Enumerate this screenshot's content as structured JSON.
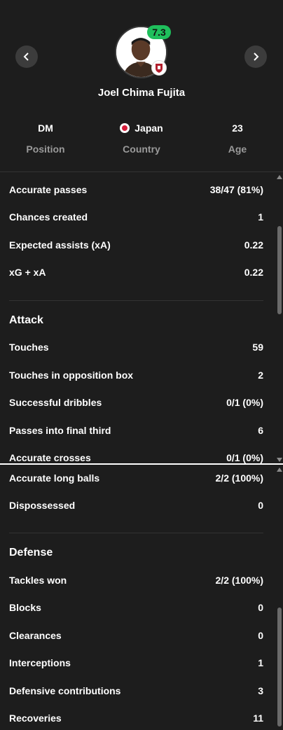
{
  "player": {
    "name": "Joel Chima Fujita",
    "rating": "7.3",
    "position_value": "DM",
    "position_label": "Position",
    "country_value": "Japan",
    "country_label": "Country",
    "age_value": "23",
    "age_label": "Age"
  },
  "panel1": {
    "rows_top": [
      {
        "label": "Accurate passes",
        "value": "38/47 (81%)"
      },
      {
        "label": "Chances created",
        "value": "1"
      },
      {
        "label": "Expected assists (xA)",
        "value": "0.22"
      },
      {
        "label": "xG + xA",
        "value": "0.22"
      }
    ],
    "attack_title": "Attack",
    "attack_rows": [
      {
        "label": "Touches",
        "value": "59"
      },
      {
        "label": "Touches in opposition box",
        "value": "2"
      },
      {
        "label": "Successful dribbles",
        "value": "0/1 (0%)"
      },
      {
        "label": "Passes into final third",
        "value": "6"
      },
      {
        "label": "Accurate crosses",
        "value": "0/1 (0%)"
      }
    ]
  },
  "panel2": {
    "rows_top": [
      {
        "label": "Accurate long balls",
        "value": "2/2 (100%)"
      },
      {
        "label": "Dispossessed",
        "value": "0"
      }
    ],
    "defense_title": "Defense",
    "defense_rows": [
      {
        "label": "Tackles won",
        "value": "2/2 (100%)"
      },
      {
        "label": "Blocks",
        "value": "0"
      },
      {
        "label": "Clearances",
        "value": "0"
      },
      {
        "label": "Interceptions",
        "value": "1"
      },
      {
        "label": "Defensive contributions",
        "value": "3"
      },
      {
        "label": "Recoveries",
        "value": "11"
      }
    ]
  },
  "colors": {
    "background": "#1d1d1d",
    "rating_badge": "#1fbf5c",
    "muted_text": "#9a9a9a"
  },
  "icons": {
    "prev": "chevron-left-icon",
    "next": "chevron-right-icon"
  }
}
